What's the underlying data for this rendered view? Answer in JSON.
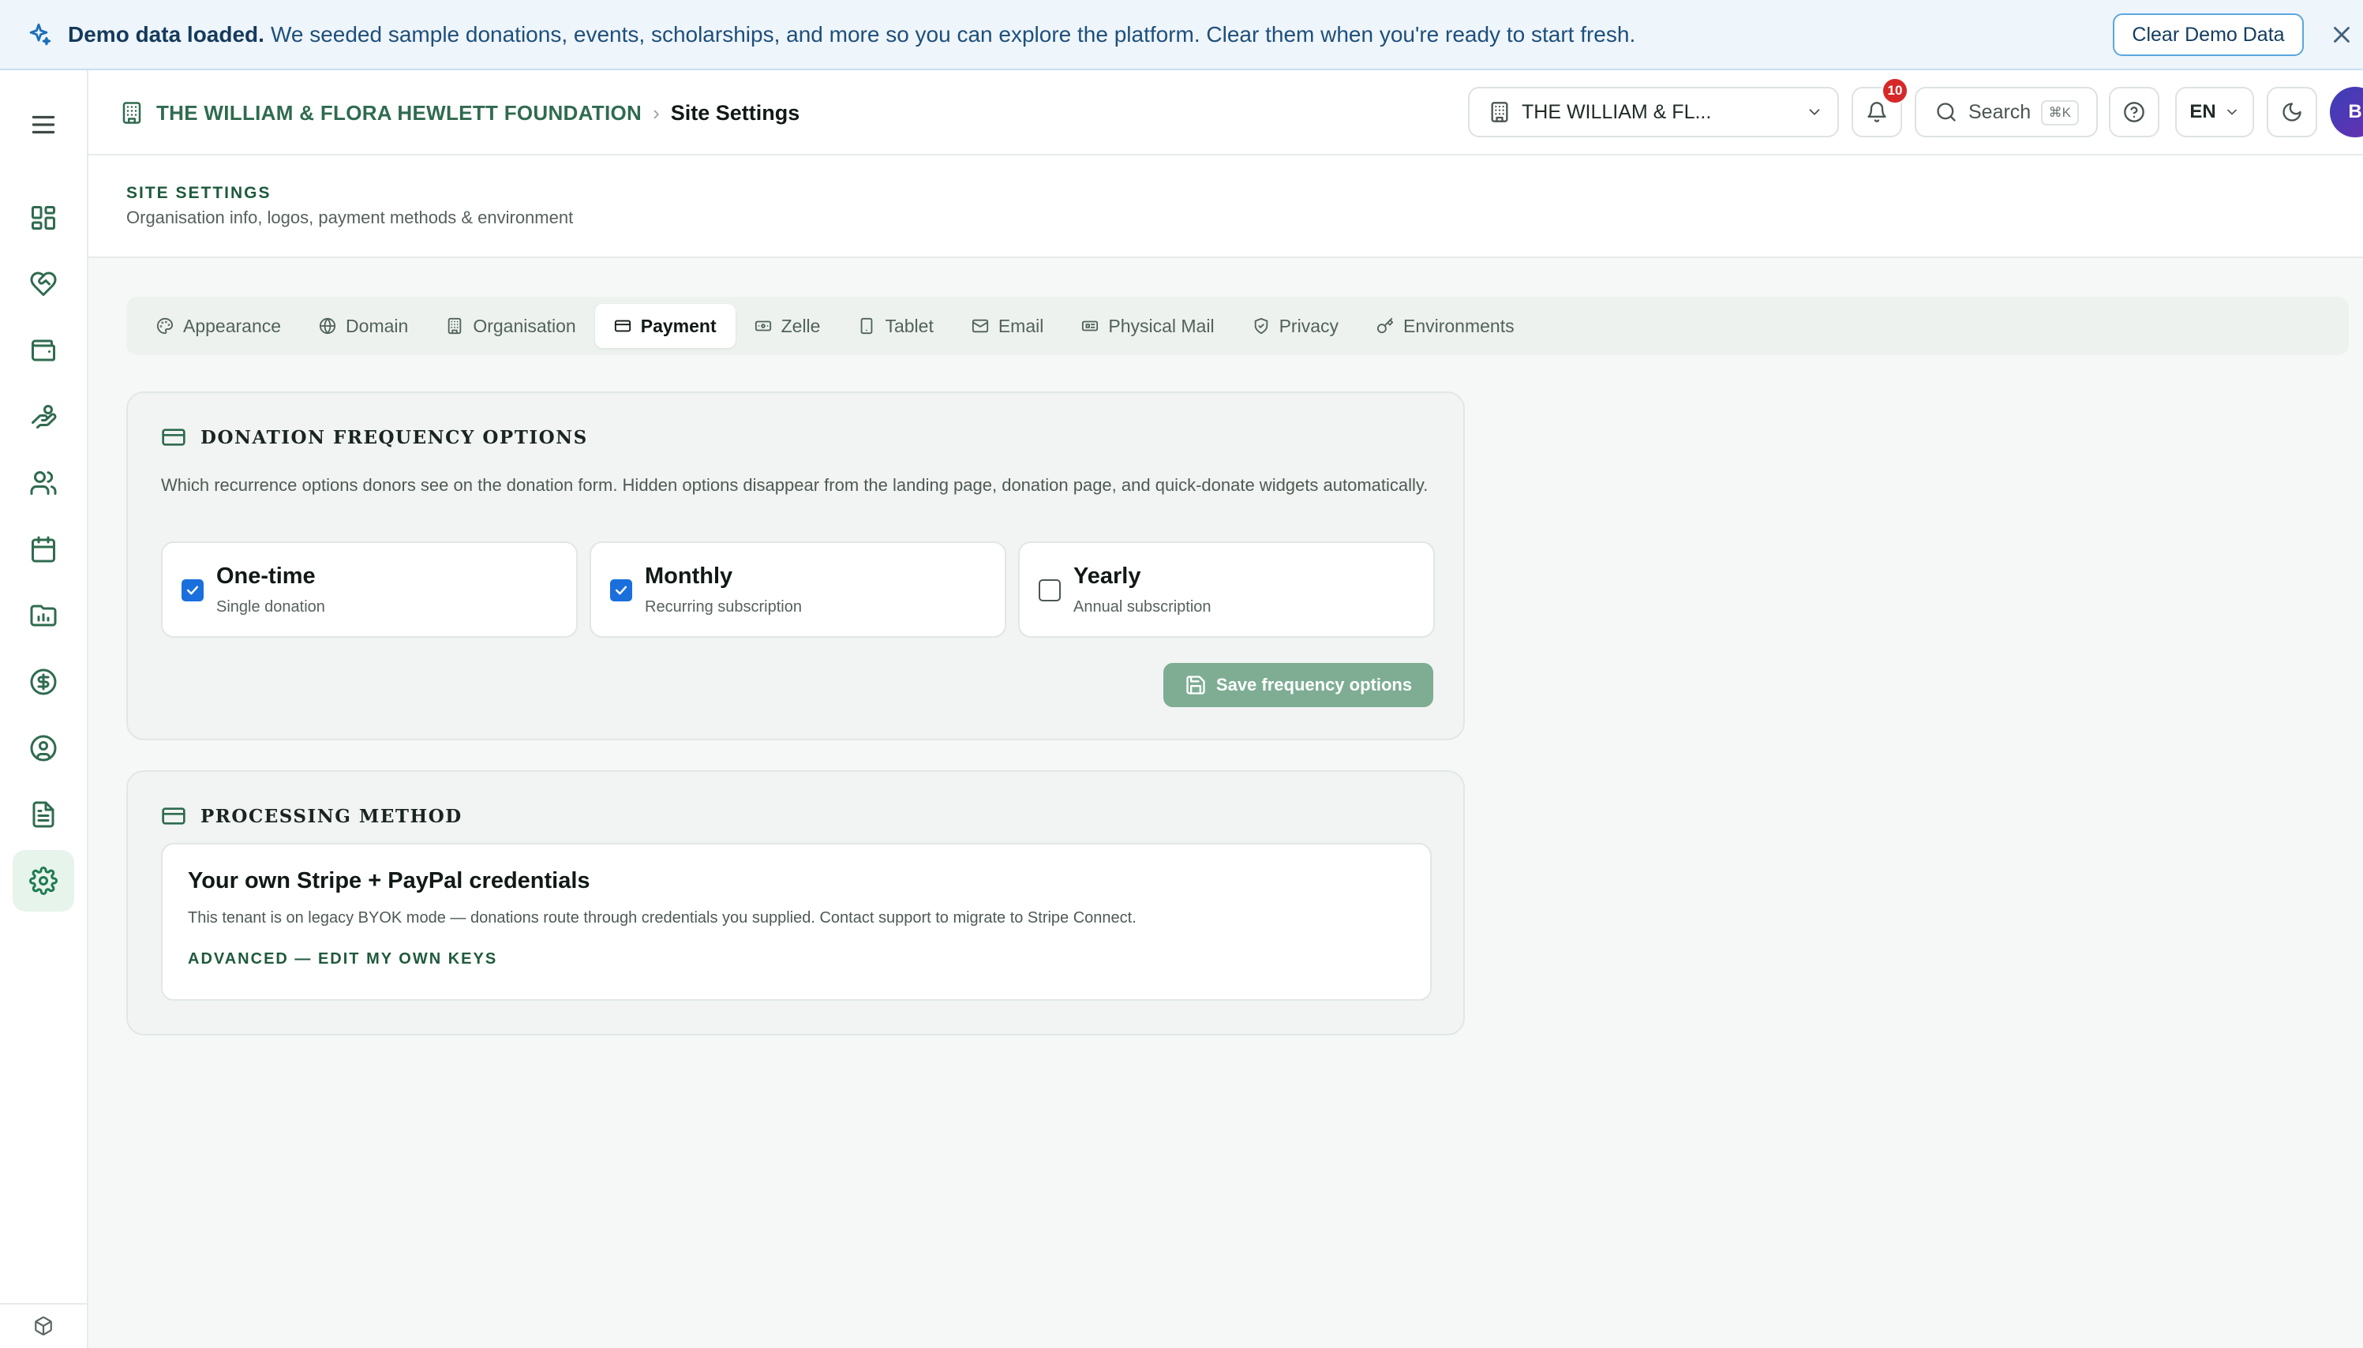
{
  "banner": {
    "title": "Demo data loaded.",
    "message": "We seeded sample donations, events, scholarships, and more so you can explore the platform. Clear them when you're ready to start fresh.",
    "clear_button": "Clear Demo Data",
    "icon": "sparkles-icon",
    "close_icon": "close-icon"
  },
  "sidebar": {
    "items": [
      {
        "icon": "dashboard-icon",
        "active": false
      },
      {
        "icon": "heart-handshake-icon",
        "active": false
      },
      {
        "icon": "wallet-icon",
        "active": false
      },
      {
        "icon": "hand-coins-icon",
        "active": false
      },
      {
        "icon": "users-icon",
        "active": false
      },
      {
        "icon": "calendar-icon",
        "active": false
      },
      {
        "icon": "folder-chart-icon",
        "active": false
      },
      {
        "icon": "dollar-circle-icon",
        "active": false
      },
      {
        "icon": "user-circle-icon",
        "active": false
      },
      {
        "icon": "document-icon",
        "active": false
      },
      {
        "icon": "gear-icon",
        "active": true
      }
    ]
  },
  "header": {
    "org_name": "THE WILLIAM & FLORA HEWLETT FOUNDATION",
    "separator": "›",
    "page": "Site Settings",
    "org_switcher": "THE WILLIAM & FL...",
    "notifications": "10",
    "search_label": "Search",
    "search_shortcut": "⌘K",
    "language": "EN",
    "avatar_initial": "B"
  },
  "page_head": {
    "eyebrow": "SITE SETTINGS",
    "subtitle": "Organisation info, logos, payment methods & environment"
  },
  "tabs": [
    {
      "label": "Appearance",
      "icon": "palette-icon"
    },
    {
      "label": "Domain",
      "icon": "globe-icon"
    },
    {
      "label": "Organisation",
      "icon": "building-icon"
    },
    {
      "label": "Payment",
      "icon": "credit-card-icon",
      "active": true
    },
    {
      "label": "Zelle",
      "icon": "banknote-icon"
    },
    {
      "label": "Tablet",
      "icon": "tablet-icon"
    },
    {
      "label": "Email",
      "icon": "mail-icon"
    },
    {
      "label": "Physical Mail",
      "icon": "stamp-icon"
    },
    {
      "label": "Privacy",
      "icon": "shield-icon"
    },
    {
      "label": "Environments",
      "icon": "key-icon"
    }
  ],
  "frequency": {
    "title": "DONATION FREQUENCY OPTIONS",
    "description": "Which recurrence options donors see on the donation form. Hidden options disappear from the landing page, donation page, and quick-donate widgets automatically.",
    "options": [
      {
        "name": "One-time",
        "hint": "Single donation",
        "checked": true
      },
      {
        "name": "Monthly",
        "hint": "Recurring subscription",
        "checked": true
      },
      {
        "name": "Yearly",
        "hint": "Annual subscription",
        "checked": false
      }
    ],
    "save_button": "Save frequency options"
  },
  "processing": {
    "title": "PROCESSING METHOD",
    "method_title": "Your own Stripe + PayPal credentials",
    "method_desc": "This tenant is on legacy BYOK mode — donations route through credentials you supplied. Contact support to migrate to Stripe Connect.",
    "advanced_link": "ADVANCED — EDIT MY OWN KEYS"
  },
  "colors": {
    "accent": "#2f6b4f",
    "banner_bg": "#eef5fb",
    "checkbox": "#1a6fdc",
    "save_button": "#7ead94",
    "badge": "#d62828"
  }
}
